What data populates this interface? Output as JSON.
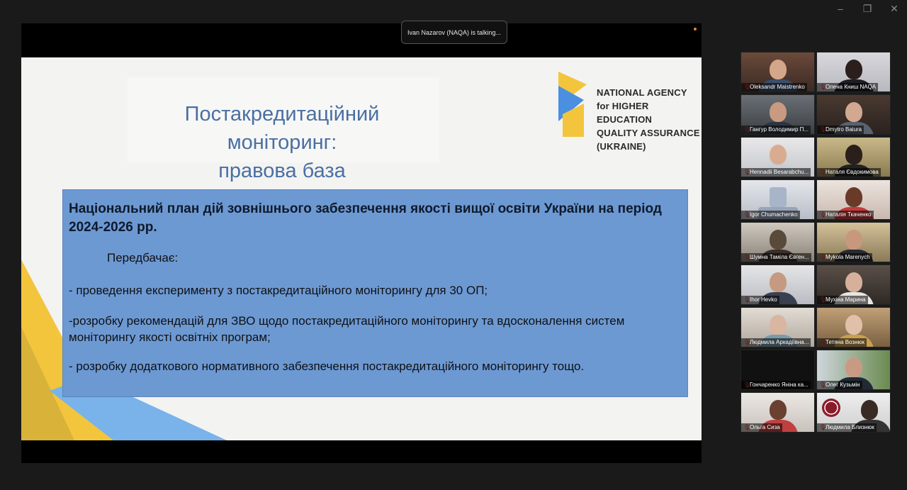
{
  "window": {
    "minimize_label": "–",
    "restore_label": "❐",
    "close_label": "✕"
  },
  "meeting": {
    "talking_indicator": "Ivan Nazarov (NAQA) is talking..."
  },
  "slide": {
    "title_line1": "Постакредитаційний моніторинг:",
    "title_line2": "правова база",
    "logo_line1": "NATIONAL AGENCY",
    "logo_line2": "for HIGHER EDUCATION",
    "logo_line3": "QUALITY ASSURANCE",
    "logo_line4": "(UKRAINE)",
    "heading": "Національний план дій зовнішнього забезпечення якості вищої освіти України на період 2024-2026 рр.",
    "sub": "Передбачає:",
    "items": [
      "- проведення експерименту з постакредитаційного моніторингу для 30 ОП;",
      "-розробку рекомендацій для ЗВО щодо постакредитаційного моніторингу та вдосконалення систем моніторингу якості освітніх програм;",
      "- розробку додаткового нормативного забезпечення постакредитаційного моніторингу тощо."
    ]
  },
  "participants": [
    {
      "name": "Oleksandr Maistrenko"
    },
    {
      "name": "Олена Книш NAQA"
    },
    {
      "name": "Гангур Володимир П..."
    },
    {
      "name": "Dmytro Baiura"
    },
    {
      "name": "Hennadii Besarabchu..."
    },
    {
      "name": "Наталя Євдокимова"
    },
    {
      "name": "Igor Chumachenko"
    },
    {
      "name": "Наталія Ткаченко"
    },
    {
      "name": "Шумна Таміла Євген..."
    },
    {
      "name": "Mykola Marenych"
    },
    {
      "name": "Ihor Hevko"
    },
    {
      "name": "Мухіна Марина"
    },
    {
      "name": "Людмила Аркадіївна..."
    },
    {
      "name": "Тетяна Вознюк"
    },
    {
      "name": "Гончаренко Яніна ка..."
    },
    {
      "name": "Олег Кузьмін"
    },
    {
      "name": "Ольга Сиза"
    },
    {
      "name": "Людмила Близнюк"
    }
  ],
  "colors": {
    "slide_title": "#4a6fa3",
    "content_box": "#6d99d3",
    "logo_blue": "#4a8fe0",
    "logo_yellow": "#f2c53d"
  }
}
